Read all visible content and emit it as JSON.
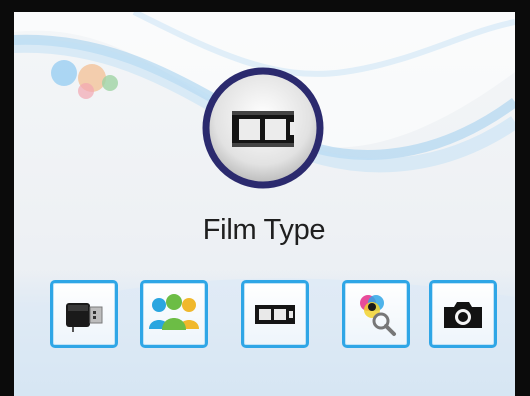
{
  "hero": {
    "title": "Film Type",
    "icon": "film-strip-icon"
  },
  "menu": [
    {
      "id": "usb",
      "icon": "usb-drive-icon"
    },
    {
      "id": "people",
      "icon": "people-group-icon"
    },
    {
      "id": "film",
      "icon": "film-strip-icon"
    },
    {
      "id": "color",
      "icon": "color-magnifier-icon"
    },
    {
      "id": "camera",
      "icon": "camera-icon"
    }
  ],
  "colors": {
    "accent": "#2fa6e6",
    "ring": "#2b2a6e",
    "wave": "#8fc3ea"
  }
}
